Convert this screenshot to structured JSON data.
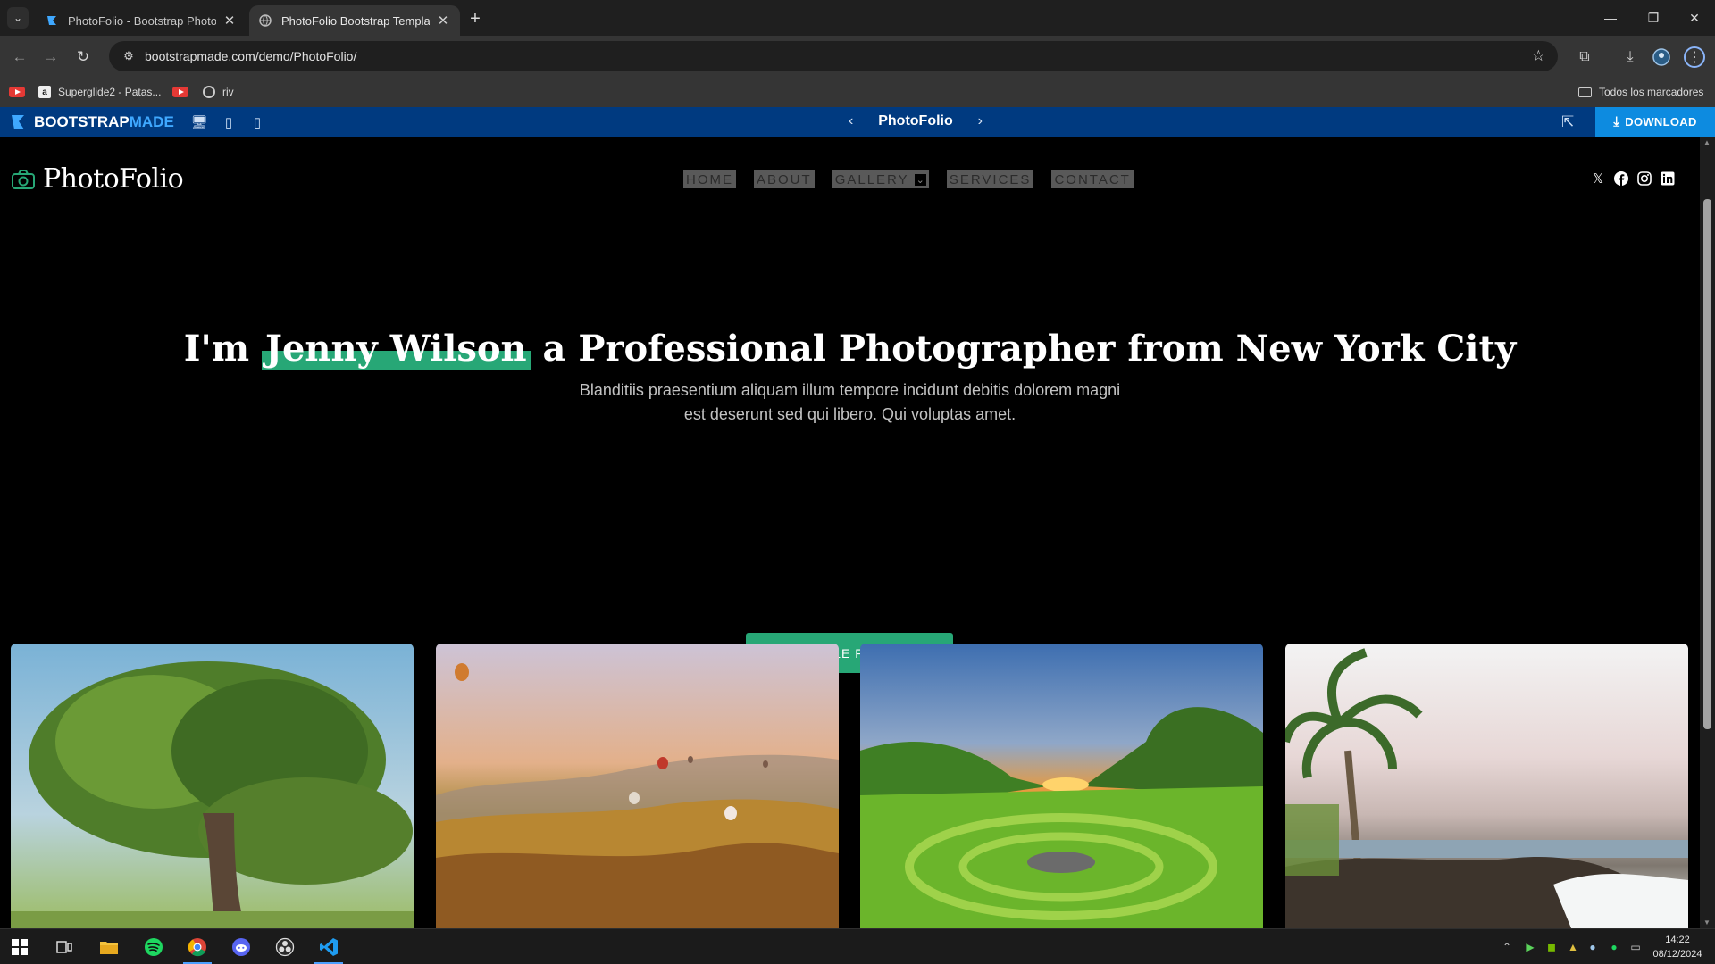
{
  "browser": {
    "tabs": [
      {
        "title": "PhotoFolio - Bootstrap Photography",
        "active": false
      },
      {
        "title": "PhotoFolio Bootstrap Template",
        "active": true
      }
    ],
    "url": "bootstrapmade.com/demo/PhotoFolio/",
    "bookmarks": [
      {
        "label": "",
        "icon": "youtube-icon"
      },
      {
        "label": "Superglide2 - Patas...",
        "icon": "amazon-icon"
      },
      {
        "label": "",
        "icon": "youtube-icon"
      },
      {
        "label": "riv",
        "icon": "globe-icon"
      }
    ],
    "all_bookmarks": "Todos los marcadores"
  },
  "bootstrapmade": {
    "brand_bold": "BOOTSTRAP",
    "brand_accent": "MADE",
    "template_name": "PhotoFolio",
    "download_label": "DOWNLOAD"
  },
  "site": {
    "logo": "PhotoFolio",
    "nav": [
      "HOME",
      "ABOUT",
      "GALLERY",
      "SERVICES",
      "CONTACT"
    ],
    "social": [
      "x-icon",
      "facebook-icon",
      "instagram-icon",
      "linkedin-icon"
    ],
    "hero": {
      "title_pre": "I'm ",
      "title_name": "Jenny Wilson",
      "title_post": " a Professional Photographer from New York City",
      "subtitle": "Blanditiis praesentium aliquam illum tempore incidunt debitis dolorem magni est deserunt sed qui libero. Qui voluptas amet.",
      "cta": "AVAILABLE FOR HIRE"
    },
    "gallery": [
      "tree-photo",
      "balloons-photo",
      "green-valley-photo",
      "beach-palm-photo"
    ]
  },
  "taskbar": {
    "time": "14:22",
    "date": "08/12/2024"
  },
  "colors": {
    "accent": "#27a776",
    "bootstrapmade_bar": "#003a80",
    "download_button": "#0d8be0"
  }
}
